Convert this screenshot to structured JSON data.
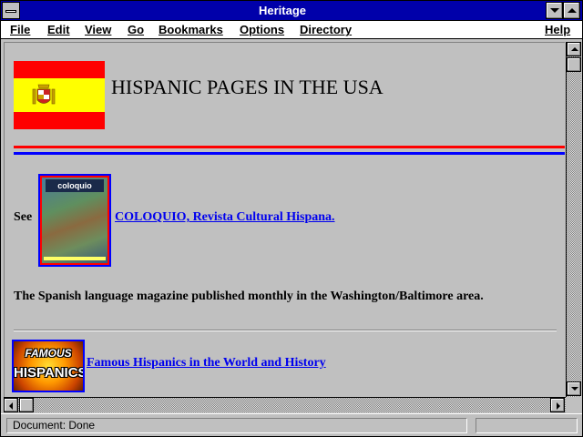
{
  "window": {
    "title": "Heritage"
  },
  "menu": {
    "items": [
      "File",
      "Edit",
      "View",
      "Go",
      "Bookmarks",
      "Options",
      "Directory"
    ],
    "help": "Help"
  },
  "page": {
    "heading": "HISPANIC PAGES IN THE USA",
    "see_label": "See",
    "coloquio_link": " COLOQUIO, Revista Cultural Hispana.",
    "magazine_cover_text": "coloquio",
    "description": "The Spanish language magazine published monthly in the Washington/Baltimore area.",
    "famous_image_text_1": "FAMOUS",
    "famous_image_text_2": "HISPANICS",
    "famous_link": "Famous Hispanics in the World and History"
  },
  "status": {
    "text": "Document: Done"
  },
  "colors": {
    "title_bar": "#0000aa",
    "flag_red": "#ff0000",
    "flag_yellow": "#ffff00",
    "link": "#0000ee",
    "rule_red": "#ff0000",
    "rule_blue": "#0000ff"
  }
}
